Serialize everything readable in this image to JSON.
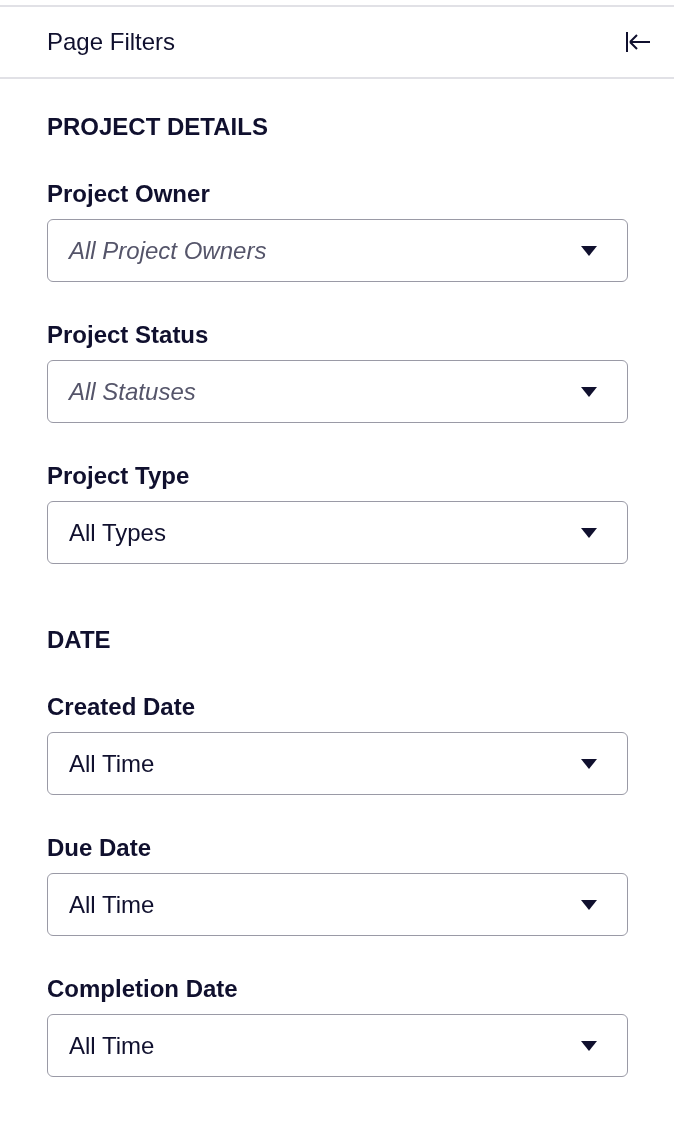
{
  "header": {
    "title": "Page Filters"
  },
  "sections": [
    {
      "title": "PROJECT DETAILS",
      "filters": [
        {
          "label": "Project Owner",
          "placeholder": "All Project Owners"
        },
        {
          "label": "Project Status",
          "placeholder": "All Statuses"
        },
        {
          "label": "Project Type",
          "value": "All Types"
        }
      ]
    },
    {
      "title": "DATE",
      "filters": [
        {
          "label": "Created Date",
          "value": "All Time"
        },
        {
          "label": "Due Date",
          "value": "All Time"
        },
        {
          "label": "Completion Date",
          "value": "All Time"
        }
      ]
    }
  ]
}
